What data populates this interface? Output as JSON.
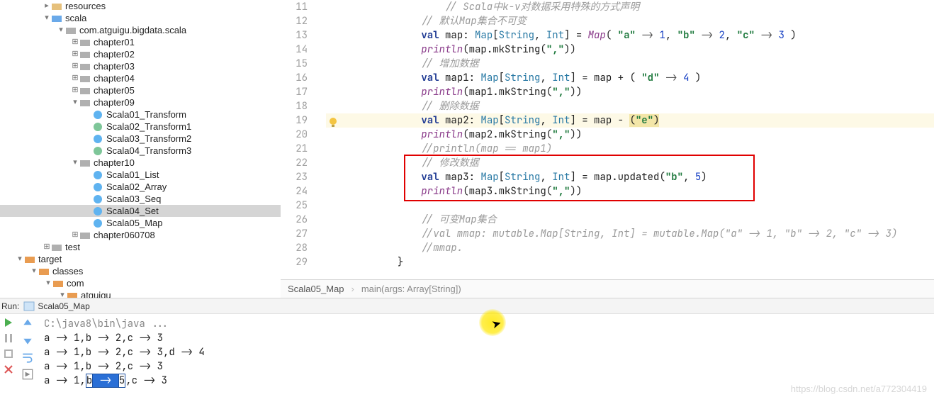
{
  "tree": {
    "resources": "resources",
    "scala": "scala",
    "pkg": "com.atguigu.bigdata.scala",
    "chapters": [
      {
        "label": "chapter01"
      },
      {
        "label": "chapter02"
      },
      {
        "label": "chapter03"
      },
      {
        "label": "chapter04"
      },
      {
        "label": "chapter05"
      }
    ],
    "chapter09": "chapter09",
    "ch09_files": [
      {
        "label": "Scala01_Transform",
        "kind": "blue"
      },
      {
        "label": "Scala02_Transform1",
        "kind": "green"
      },
      {
        "label": "Scala03_Transform2",
        "kind": "blue"
      },
      {
        "label": "Scala04_Transform3",
        "kind": "green"
      }
    ],
    "chapter10": "chapter10",
    "ch10_files": [
      {
        "label": "Scala01_List",
        "kind": "blue"
      },
      {
        "label": "Scala02_Array",
        "kind": "blue"
      },
      {
        "label": "Scala03_Seq",
        "kind": "blue"
      },
      {
        "label": "Scala04_Set",
        "kind": "blue",
        "selected": true
      },
      {
        "label": "Scala05_Map",
        "kind": "blue"
      }
    ],
    "chapter060708": "chapter060708",
    "test": "test",
    "target": "target",
    "classes": "classes",
    "com": "com",
    "atguigu": "atguigu"
  },
  "editor": {
    "lines": {
      "11": {
        "indent": 5,
        "comment": "// Scala中k-v对数据采用特殊的方式声明"
      },
      "12": {
        "indent": 4,
        "comment": "// 默认Map集合不可变"
      },
      "13": {
        "indent": 4,
        "code_map_decl": {
          "name": "map",
          "items": [
            [
              "a",
              1
            ],
            [
              "b",
              2
            ],
            [
              "c",
              3
            ]
          ]
        }
      },
      "14": {
        "indent": 4,
        "println": "map"
      },
      "15": {
        "indent": 4,
        "comment": "// 增加数据"
      },
      "16": {
        "indent": 4,
        "code_map_plus": {
          "name": "map1",
          "base": "map",
          "add_key": "d",
          "add_val": 4
        }
      },
      "17": {
        "indent": 4,
        "println": "map1"
      },
      "18": {
        "indent": 4,
        "comment": "// 删除数据"
      },
      "19": {
        "indent": 4,
        "code_map_minus": {
          "name": "map2",
          "base": "map",
          "remove_key": "e"
        },
        "highlight": true
      },
      "20": {
        "indent": 4,
        "println": "map2"
      },
      "21": {
        "indent": 4,
        "comment": "//println(map == map1)"
      },
      "22": {
        "indent": 4,
        "comment": "// 修改数据"
      },
      "23": {
        "indent": 4,
        "code_map_updated": {
          "name": "map3",
          "base": "map",
          "key": "b",
          "val": 5
        }
      },
      "24": {
        "indent": 4,
        "println": "map3"
      },
      "25": {
        "indent": 0,
        "blank": true
      },
      "26": {
        "indent": 4,
        "comment": "// 可变Map集合"
      },
      "27": {
        "indent": 4,
        "comment": "//val mmap: mutable.Map[String, Int] = mutable.Map(\"a\" -> 1, \"b\" -> 2, \"c\" -> 3)"
      },
      "28": {
        "indent": 4,
        "comment": "//mmap."
      },
      "29": {
        "indent": 3,
        "brace": "}"
      }
    },
    "breadcrumb": {
      "current": "Scala05_Map",
      "method": "main(args: Array[String])"
    },
    "literal": {
      "string_type": "String",
      "int_type": "Int",
      "map_type": "Map"
    }
  },
  "run": {
    "label": "Run:",
    "config": "Scala05_Map"
  },
  "console": {
    "cmd": "C:\\java8\\bin\\java ...",
    "lines": [
      "a -> 1,b -> 2,c -> 3",
      "a -> 1,b -> 2,c -> 3,d -> 4",
      "a -> 1,b -> 2,c -> 3",
      {
        "pre": "a -> 1,",
        "sel_pre": "b",
        "sel_mid": " -> ",
        "sel_suf": "5",
        "post": ",c -> 3"
      }
    ]
  },
  "watermark": "https://blog.csdn.net/a772304419"
}
